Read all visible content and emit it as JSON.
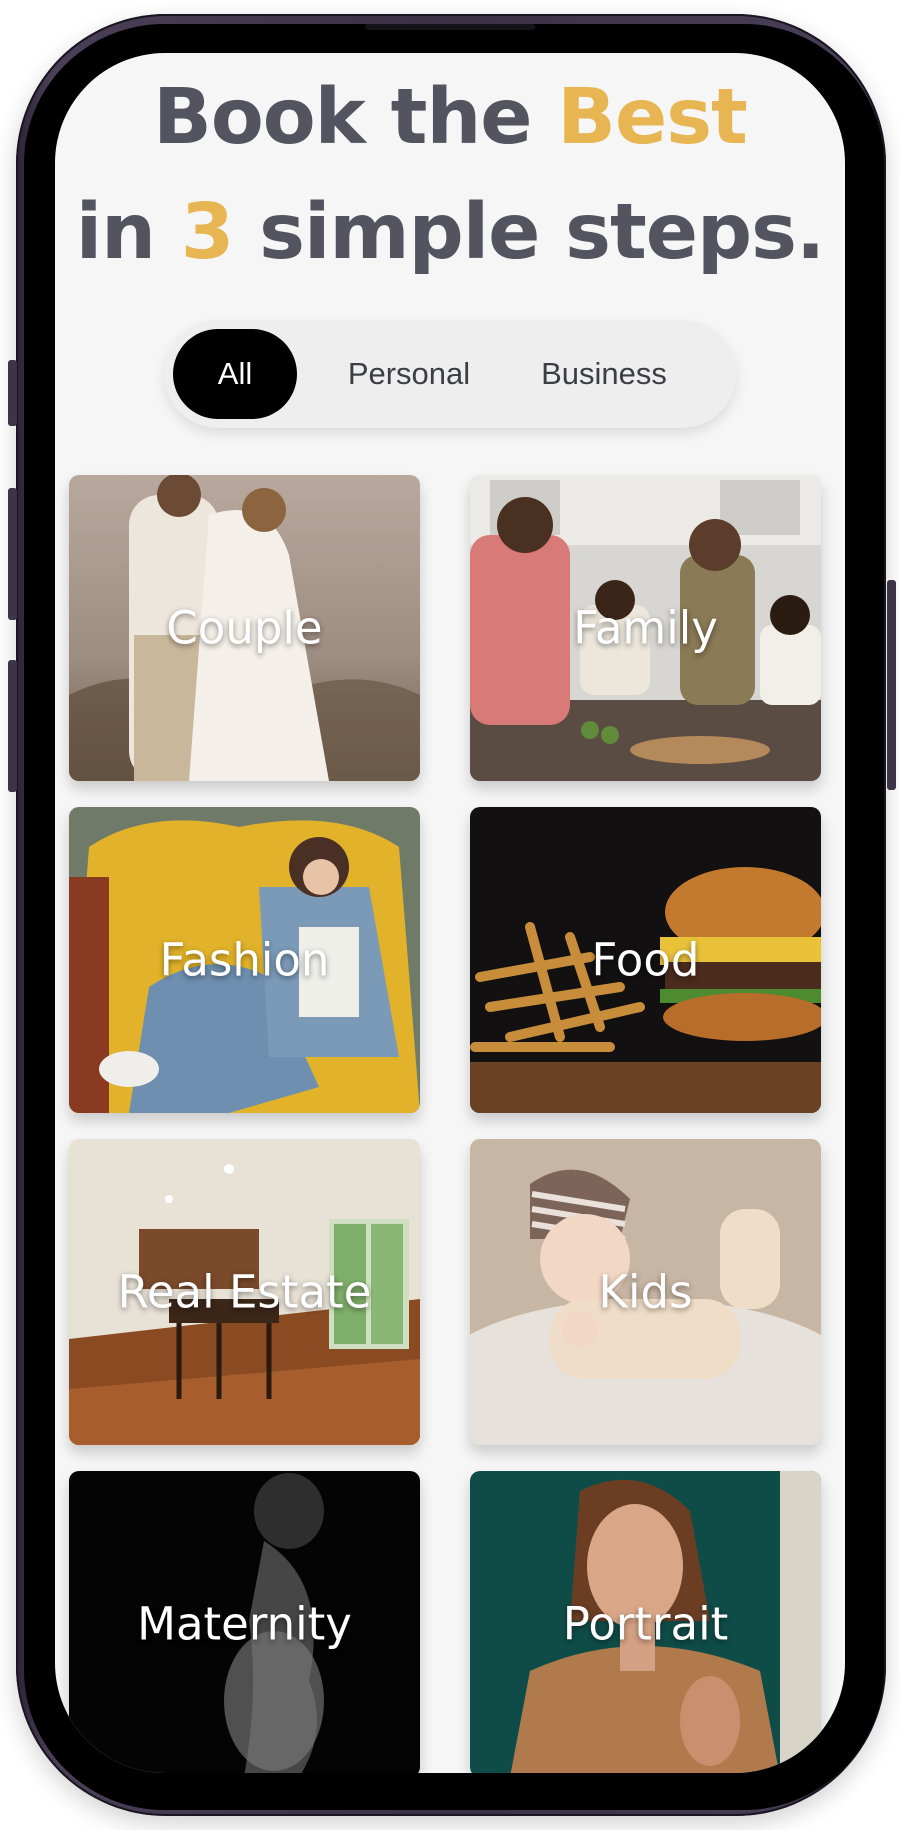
{
  "headline": {
    "line1_prefix": "Book the ",
    "line1_accent": "Best",
    "line2_prefix": "in ",
    "line2_accent": "3",
    "line2_suffix": " simple steps."
  },
  "colors": {
    "accent": "#e7b653",
    "text": "#545461",
    "active_tab": "#000000"
  },
  "filters": {
    "selected": "All",
    "tabs": [
      {
        "label": "All"
      },
      {
        "label": "Personal"
      },
      {
        "label": "Business"
      }
    ]
  },
  "categories": [
    {
      "label": "Couple"
    },
    {
      "label": "Family"
    },
    {
      "label": "Fashion"
    },
    {
      "label": "Food"
    },
    {
      "label": "Real Estate"
    },
    {
      "label": "Kids"
    },
    {
      "label": "Maternity"
    },
    {
      "label": "Portrait"
    }
  ]
}
